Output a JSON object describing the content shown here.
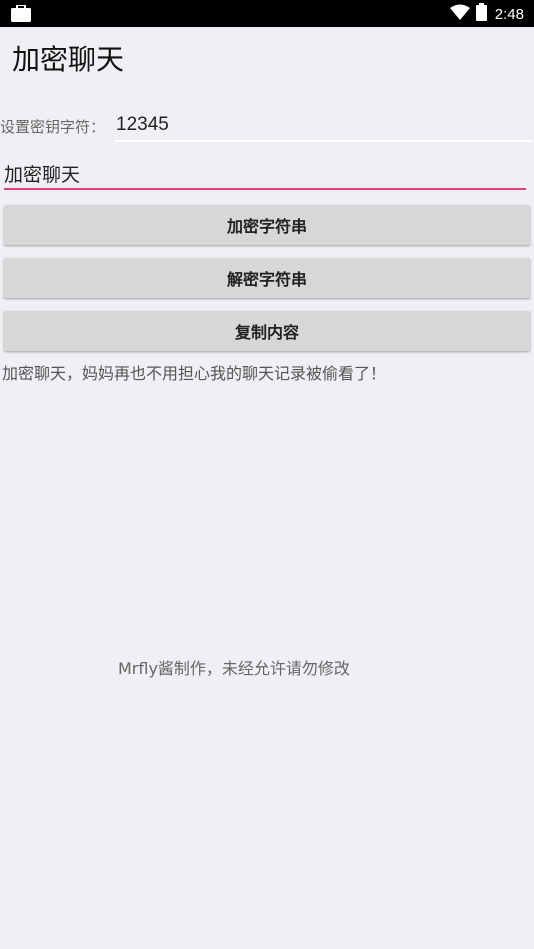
{
  "status_bar": {
    "time": "2:48",
    "left_icon": "briefcase-icon",
    "right_icons": [
      "wifi-icon",
      "battery-icon"
    ]
  },
  "app": {
    "title": "加密聊天"
  },
  "key": {
    "label": "设置密钥字符：",
    "value": "12345"
  },
  "message": {
    "value": "加密聊天"
  },
  "buttons": {
    "encrypt": "加密字符串",
    "decrypt": "解密字符串",
    "copy": "复制内容"
  },
  "result_text": "加密聊天，妈妈再也不用担心我的聊天记录被偷看了！",
  "footer_text": "Mrfly酱制作，未经允许请勿修改",
  "colors": {
    "accent": "#e0417c",
    "background": "#f0eff4",
    "button": "#d7d7d7"
  }
}
